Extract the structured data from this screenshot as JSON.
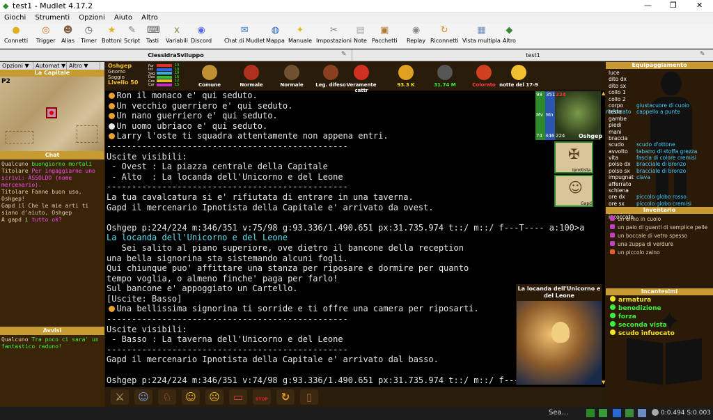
{
  "window": {
    "title": "test1 - Mudlet 4.17.2",
    "minimize": "—",
    "maximize": "❐",
    "close": "✕"
  },
  "menu": [
    "Giochi",
    "Strumenti",
    "Opzioni",
    "Aiuto",
    "Altro"
  ],
  "toolbar": [
    {
      "label": "Connetti",
      "icon": "connect-icon",
      "color": "#e0b020",
      "glyph": "●"
    },
    {
      "label": "Trigger",
      "icon": "trigger-icon",
      "color": "#d07020",
      "glyph": "◎"
    },
    {
      "label": "Alias",
      "icon": "alias-icon",
      "color": "#806040",
      "glyph": "☻"
    },
    {
      "label": "Timer",
      "icon": "timer-icon",
      "color": "#555",
      "glyph": "◷"
    },
    {
      "label": "Bottoni",
      "icon": "star-icon",
      "color": "#e0b020",
      "glyph": "★"
    },
    {
      "label": "Script",
      "icon": "script-icon",
      "color": "#777",
      "glyph": "✎"
    },
    {
      "label": "Tasti",
      "icon": "keyboard-icon",
      "color": "#555",
      "glyph": "⌨"
    },
    {
      "label": "Variabili",
      "icon": "variables-icon",
      "color": "#6a8f3a",
      "glyph": "x"
    },
    {
      "label": "Discord",
      "icon": "discord-icon",
      "color": "#5865f2",
      "glyph": "◉"
    },
    {
      "label": "Chat di Mudlet",
      "icon": "chat-icon",
      "color": "#3a7ad0",
      "glyph": "✉"
    },
    {
      "label": "Mappa",
      "icon": "globe-icon",
      "color": "#2a66c0",
      "glyph": "◍"
    },
    {
      "label": "Manuale",
      "icon": "bulb-icon",
      "color": "#e0c020",
      "glyph": "✦"
    },
    {
      "label": "Impostazioni",
      "icon": "wrench-icon",
      "color": "#777",
      "glyph": "✂"
    },
    {
      "label": "Note",
      "icon": "notes-icon",
      "color": "#aaa",
      "glyph": "▤"
    },
    {
      "label": "Pacchetti",
      "icon": "package-icon",
      "color": "#b07a30",
      "glyph": "▣"
    },
    {
      "label": "Replay",
      "icon": "replay-icon",
      "color": "#888",
      "glyph": "◉"
    },
    {
      "label": "Riconnetti",
      "icon": "reconnect-icon",
      "color": "#e09020",
      "glyph": "↻"
    },
    {
      "label": "Vista multipla",
      "icon": "multiview-icon",
      "color": "#6b8fc0",
      "glyph": "▦"
    },
    {
      "label": "Altro",
      "icon": "more-icon",
      "color": "#3a8a3a",
      "glyph": "◆"
    }
  ],
  "tabs": [
    "ClessidraSviluppo",
    "test1"
  ],
  "left": {
    "dropdowns": [
      "Opzioni ▼",
      "Automat ▼",
      "Altro ▼"
    ],
    "map_title": "La Capitale",
    "map_badge": "P2",
    "chat_title": "Chat",
    "chat": [
      {
        "who": "Qualcuno ",
        "text": "buongiorno mortali",
        "color": "#3df03d"
      },
      {
        "who": "Titolare ",
        "text": "Per ingaggiarne uno scrivi: ASSOLDO (nome mercenario).",
        "color": "#ff4af7"
      },
      {
        "who": "Titolare ",
        "text": "Fanne buon uso, Oshgep!",
        "color": "#e0d0b0"
      },
      {
        "who": "Gapd il  ",
        "text": "Che le mie arti ti siano d'aiuto, Oshgep",
        "color": "#e0d0b0"
      },
      {
        "who": "A gapd i ",
        "text": "tutto ok?",
        "color": "#ff4af7"
      }
    ],
    "alerts_title": "Avvisi",
    "alerts": [
      {
        "who": "Qualcuno ",
        "text": "Tra poco ci sara' un fantastico raduno!",
        "color": "#3df03d"
      }
    ]
  },
  "status": {
    "name": "Oshgep",
    "race": "Gnomo",
    "title": "Saggio",
    "level": "Livello 50",
    "bars": [
      {
        "label": "For",
        "value": "13",
        "color": "#e03030"
      },
      {
        "label": "Int",
        "value": "19",
        "color": "#3060e0"
      },
      {
        "label": "Sag",
        "value": "19",
        "color": "#30b0e0"
      },
      {
        "label": "Des",
        "value": "16",
        "color": "#30c030"
      },
      {
        "label": "Cos",
        "value": "12",
        "color": "#e0c030"
      },
      {
        "label": "Car",
        "value": "15",
        "color": "#c030c0"
      }
    ],
    "items": [
      {
        "label": "Comune",
        "icon": "warrior-face-icon",
        "color": "#c09030",
        "lcolor": "#fff"
      },
      {
        "label": "Normale",
        "icon": "target-icon",
        "color": "#b03020",
        "lcolor": "#fff"
      },
      {
        "label": "Normale",
        "icon": "crossed-swords-icon",
        "color": "#705030",
        "lcolor": "#fff"
      },
      {
        "label": "Leg. difeso",
        "icon": "shield-icon",
        "color": "#8a4020",
        "lcolor": "#fff"
      },
      {
        "label": "Veramente cattr",
        "icon": "devil-icon",
        "color": "#d03020",
        "lcolor": "#fff"
      },
      {
        "label": "93.3 K",
        "icon": "money-bag-icon",
        "color": "#e0a020",
        "lcolor": "#f0e020"
      },
      {
        "label": "31.74 M",
        "icon": "stars-icon",
        "color": "#555",
        "lcolor": "#3df03d"
      },
      {
        "label": "Colorato",
        "icon": "castle-icon",
        "color": "#d04020",
        "lcolor": "#ff4040"
      },
      {
        "label": "notte del 17-9",
        "icon": "weather-icon",
        "color": "#f0c030",
        "lcolor": "#fff"
      }
    ]
  },
  "portrait": {
    "name": "Oshgep",
    "hp": "224",
    "mp": "351",
    "mv": "98",
    "mv2": "74",
    "mp2": "346",
    "hp2": "224",
    "hv": "Mv",
    "mn": "Mn"
  },
  "party": [
    {
      "name": "Ipnotista"
    },
    {
      "name": "Gapd"
    }
  ],
  "scene_title": "La locanda dell'Unicorno e del Leone",
  "console": [
    {
      "t": "  Ron il monaco e' qui seduto.",
      "icon": "#e8a030"
    },
    {
      "t": "  Un vecchio guerriero e' qui seduto.",
      "icon": "#e8a030"
    },
    {
      "t": "  Un nano guerriero e' qui seduto.",
      "icon": "#e8a030"
    },
    {
      "t": "  Un uomo ubriaco e' qui seduto.",
      "icon": "#e8e8e8"
    },
    {
      "t": "  Larry l'oste ti squadra attentamente non appena entri.",
      "icon": "#e8a030"
    },
    {
      "t": "------------------------------------------------"
    },
    {
      "t": "Uscite visibili:"
    },
    {
      "t": " - Ovest : La piazza centrale della Capitale"
    },
    {
      "t": " - Alto  : La locanda dell'Unicorno e del Leone"
    },
    {
      "t": "------------------------------------------------"
    },
    {
      "t": "La tua cavalcatura si e' rifiutata di entrare in una taverna."
    },
    {
      "t": "Gapd il mercenario Ipnotista della Capitale e' arrivato da ovest."
    },
    {
      "t": ""
    },
    {
      "t": "Oshgep p:224/224 m:346/351 v:75/98 g:93.336/1.490.651 px:31.735.974 t::/ m::/ f---T---- a:100>a"
    },
    {
      "t": "La locanda dell'Unicorno e del Leone",
      "cls": "cyan"
    },
    {
      "t": "   Sei salito al piano superiore, ove dietro il bancone della reception"
    },
    {
      "t": "una bella signorina sta sistemando alcuni fogli."
    },
    {
      "t": "Qui chiunque puo' affittare una stanza per riposare e dormire per quanto"
    },
    {
      "t": "tempo voglia, o almeno finche' paga per farlo!"
    },
    {
      "t": "Sul bancone e' appoggiato un Cartello."
    },
    {
      "t": "[Uscite: Basso]"
    },
    {
      "t": "  Una bellissima signorina ti sorride e ti offre una camera per riposarti.",
      "icon": "#e8a030"
    },
    {
      "t": "------------------------------------------------"
    },
    {
      "t": "Uscite visibili:"
    },
    {
      "t": " - Basso : La taverna dell'Unicorno e del Leone"
    },
    {
      "t": "------------------------------------------------"
    },
    {
      "t": "Gapd il mercenario Ipnotista della Capitale e' arrivato dal basso."
    },
    {
      "t": ""
    },
    {
      "t": "Oshgep p:224/224 m:346/351 v:74/98 g:93.336/1.490.651 px:31.735.974 t::/ m::/ f---"
    }
  ],
  "bottombar": [
    {
      "icon": "swords-icon",
      "glyph": "⚔",
      "color": "#d0b070"
    },
    {
      "icon": "group-icon",
      "glyph": "☺",
      "color": "#70a0e0"
    },
    {
      "icon": "runner-icon",
      "glyph": "♘",
      "color": "#e06040"
    },
    {
      "icon": "smile-icon",
      "glyph": "☺",
      "color": "#f0c020"
    },
    {
      "icon": "sleepy-face-icon",
      "glyph": "☹",
      "color": "#f0c020"
    },
    {
      "icon": "bed-icon",
      "glyph": "▭",
      "color": "#e04040"
    },
    {
      "icon": "stop-icon",
      "glyph": "STOP",
      "color": "#e02020"
    },
    {
      "icon": "refresh-icon",
      "glyph": "↻",
      "color": "#f0a020"
    },
    {
      "icon": "door-icon",
      "glyph": "▯",
      "color": "#a06030"
    }
  ],
  "equip": {
    "title": "Equipaggiamento",
    "rows": [
      {
        "k": "luce",
        "v": ""
      },
      {
        "k": "dito dx",
        "v": ""
      },
      {
        "k": "dito sx",
        "v": ""
      },
      {
        "k": "collo 1",
        "v": ""
      },
      {
        "k": "collo 2",
        "v": ""
      },
      {
        "k": "corpo",
        "v": "giustacuore di cuoio rinforzato"
      },
      {
        "k": "testa",
        "v": "cappello a punte"
      },
      {
        "k": "gambe",
        "v": ""
      },
      {
        "k": "piedi",
        "v": ""
      },
      {
        "k": "mani",
        "v": ""
      },
      {
        "k": "braccia",
        "v": ""
      },
      {
        "k": "scudo",
        "v": "scudo d'ottone"
      },
      {
        "k": "avvolto",
        "v": "tabarro di stoffa grezza"
      },
      {
        "k": "vita",
        "v": "fascia di colore cremisi"
      },
      {
        "k": "polso dx",
        "v": "bracciale di bronzo"
      },
      {
        "k": "polso sx",
        "v": "bracciale di bronzo"
      },
      {
        "k": "impugnat",
        "v": "clava"
      },
      {
        "k": "afferrato",
        "v": ""
      },
      {
        "k": "schiena",
        "v": ""
      },
      {
        "k": "ore dx",
        "v": "piccolo globo rosso"
      },
      {
        "k": "ore sx",
        "v": "piccolo globo cremisi"
      },
      {
        "k": "occhi",
        "v": ""
      },
      {
        "k": "incoccato",
        "v": ""
      }
    ]
  },
  "inventory": {
    "title": "Inventario",
    "items": [
      {
        "t": "un elmo in cuoio",
        "c": "#c040c0"
      },
      {
        "t": "un paio di guanti di semplice pelle",
        "c": "#c040c0"
      },
      {
        "t": "un boccale di vetro spesso",
        "c": "#c040c0"
      },
      {
        "t": "una zuppa di verdure",
        "c": "#c040c0"
      },
      {
        "t": "un piccolo zaino",
        "c": "#e06030"
      }
    ]
  },
  "spells": {
    "title": "Incantesimi",
    "items": [
      {
        "t": "armatura",
        "c": "#f1e51f"
      },
      {
        "t": "benedizione",
        "c": "#3df03d"
      },
      {
        "t": "forza",
        "c": "#3df03d"
      },
      {
        "t": "seconda vista",
        "c": "#3df03d"
      },
      {
        "t": "scudo infuocato",
        "c": "#f1e51f"
      }
    ]
  },
  "taskbar": {
    "search": "Sea...",
    "clock": "0:0.494 S:0.003"
  }
}
